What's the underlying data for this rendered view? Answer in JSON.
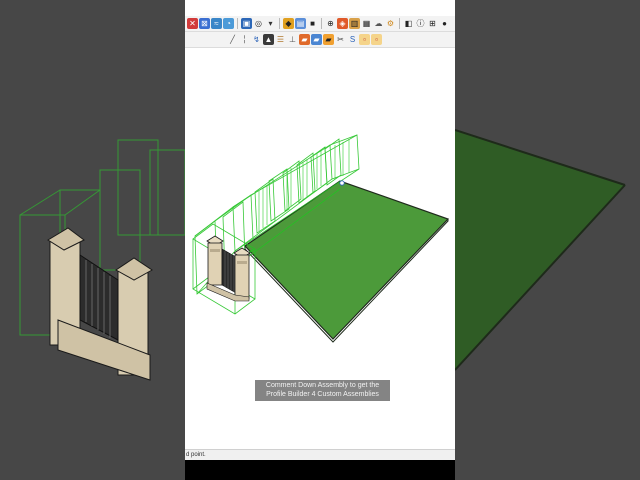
{
  "caption": {
    "line1": "Comment Down Assembly to get the",
    "line2": "Profile Builder 4 Custom Assemblies"
  },
  "statusbar": {
    "text": "d point."
  },
  "toolbar": {
    "row1_icons": [
      "select-icon",
      "eraser-icon",
      "line-icon",
      "arc-icon",
      "shapes-icon",
      "pushpull-icon",
      "orbit-icon",
      "component-icon",
      "layers-icon",
      "paint-icon",
      "section-icon",
      "solid-tools-icon",
      "extension-icon",
      "cloud-icon",
      "settings-icon",
      "warehouse-icon",
      "info-icon",
      "cart-icon",
      "user-icon"
    ],
    "row2_icons": [
      "pencil-icon",
      "brush-icon",
      "profile-icon",
      "assembly-icon",
      "stairs-icon",
      "fence-icon",
      "tool-a-icon",
      "tool-b-icon",
      "tool-c-icon",
      "scissors-icon",
      "snake-icon",
      "square-a-icon",
      "square-b-icon"
    ]
  },
  "colors": {
    "ground": "#4c9a3a",
    "ground_edge": "#2b4a25",
    "selection": "#22c322",
    "pillar_stone": "#e8dcc2",
    "gate": "#2a2a2a",
    "backdrop_gray": "#4a4a4a",
    "backdrop_green": "#2e5a24"
  }
}
